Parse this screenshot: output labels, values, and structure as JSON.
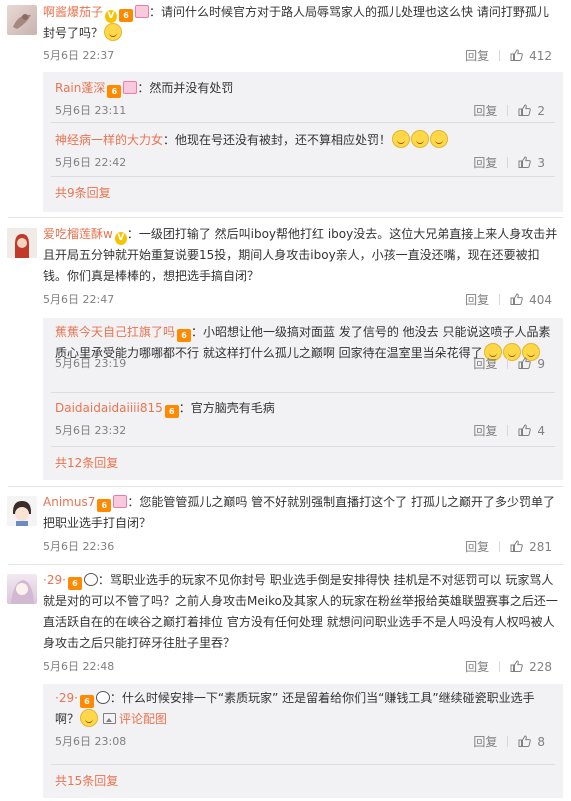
{
  "reply_label": "回复",
  "comments": [
    {
      "username": "啊酱爆茄子",
      "text": "：请问什么时候官方对于路人局辱骂家人的孤儿处理也这么快 请问打野孤儿封号了吗？",
      "time": "5月6日 22:37",
      "likes": "412",
      "replies": [
        {
          "username": "Rain蓬深",
          "text": "：然而并没有处罚",
          "time": "5月6日 23:11",
          "likes": "2"
        },
        {
          "username": "神经病一样的大力女",
          "text": "：他现在号还没有被封，还不算相应处罚！",
          "time": "5月6日 22:42",
          "likes": "3"
        }
      ],
      "more": "共9条回复"
    },
    {
      "username": "爱吃榴莲酥w",
      "text": "：一级团打输了 然后叫iboy帮他打红 iboy没去。这位大兄弟直接上来人身攻击并且开局五分钟就开始重复说要15投，期间人身攻击iboy亲人，小孩一直没还嘴，现在还要被扣钱。你们真是棒棒的，想把选手搞自闭？",
      "time": "5月6日 22:47",
      "likes": "404",
      "replies": [
        {
          "username": "蕉蕉今天自己扛旗了吗",
          "text": "：小昭想让他一级搞对面蓝 发了信号的 他没去 只能说这喷子人品素质心里承受能力哪哪都不行 就这样打什么孤儿之巅啊 回家待在温室里当朵花得了",
          "time": "5月6日 23:19",
          "likes": "9"
        },
        {
          "username": "Daidaidaidaiiii815",
          "text": "：官方脑壳有毛病",
          "time": "5月6日 23:32",
          "likes": "4"
        }
      ],
      "more": "共12条回复"
    },
    {
      "username": "Animus7",
      "text": "：您能管管孤儿之巅吗 管不好就别强制直播打这个了 打孤儿之巅开了多少罚单了 把职业选手打自闭？",
      "time": "5月6日 22:36",
      "likes": "281"
    },
    {
      "username": "·29·",
      "text": "：骂职业选手的玩家不见你封号 职业选手倒是安排得快 挂机是不对惩罚可以 玩家骂人就是对的可以不管了吗？之前人身攻击Meiko及其家人的玩家在粉丝举报给英雄联盟赛事之后还一直活跃自在的在峡谷之巅打着排位 官方没有任何处理  就想问问职业选手不是人吗没有人权吗被人身攻击之后只能打碎牙往肚子里吞？",
      "time": "5月6日 22:48",
      "likes": "228",
      "replies": [
        {
          "username": "·29·",
          "text": "：什么时候安排一下“素质玩家” 还是留着给你们当“赚钱工具”继续碰瓷职业选手啊？",
          "pic_label": "评论配图",
          "time": "5月6日 23:08",
          "likes": "8"
        }
      ],
      "more": "共15条回复"
    }
  ]
}
